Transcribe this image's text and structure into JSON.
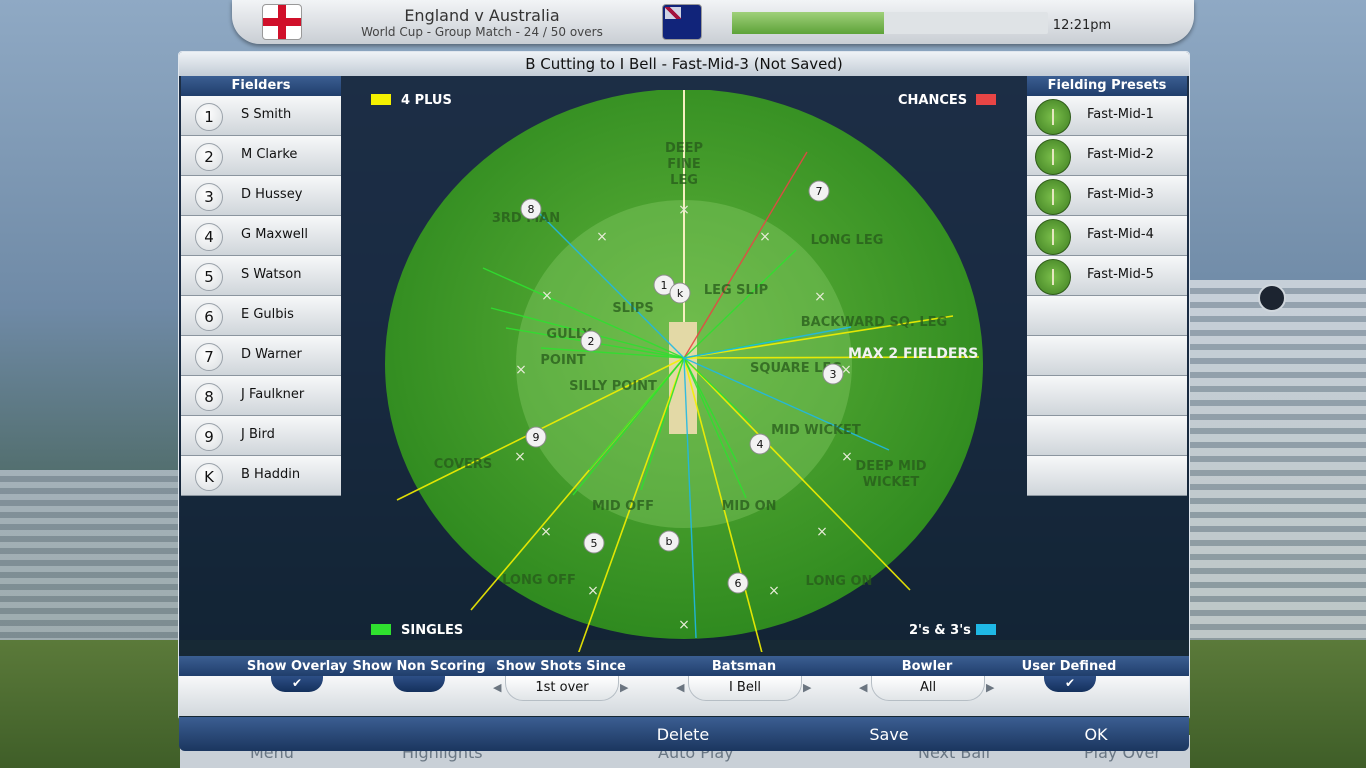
{
  "scoreboard": {
    "match_title": "England v Australia",
    "match_sub": "World Cup - Group Match - 24 / 50 overs",
    "clock": "12:21pm",
    "progress": 0.48
  },
  "background_nav": [
    "Menu",
    "Highlights",
    "Auto Play",
    "Next Ball",
    "Play Over"
  ],
  "dialog": {
    "title": "B Cutting to I Bell - Fast-Mid-3 (Not Saved)"
  },
  "fielders": {
    "heading": "Fielders",
    "items": [
      {
        "num": "1",
        "name": "S Smith"
      },
      {
        "num": "2",
        "name": "M Clarke"
      },
      {
        "num": "3",
        "name": "D Hussey"
      },
      {
        "num": "4",
        "name": "G Maxwell"
      },
      {
        "num": "5",
        "name": "S Watson"
      },
      {
        "num": "6",
        "name": "E Gulbis"
      },
      {
        "num": "7",
        "name": "D Warner"
      },
      {
        "num": "8",
        "name": "J Faulkner"
      },
      {
        "num": "9",
        "name": "J Bird"
      },
      {
        "num": "K",
        "name": "B Haddin"
      }
    ]
  },
  "presets": {
    "heading": "Fielding Presets",
    "items": [
      "Fast-Mid-1",
      "Fast-Mid-2",
      "Fast-Mid-3",
      "Fast-Mid-4",
      "Fast-Mid-5"
    ]
  },
  "legend": {
    "four_plus": "4 PLUS",
    "chances": "CHANCES",
    "singles": "SINGLES",
    "twos_threes": "2's & 3's",
    "max_fielders": "MAX 2 FIELDERS",
    "colors": {
      "four_plus": "#f4f000",
      "chances": "#e84545",
      "singles": "#2fe02f",
      "twos_threes": "#1fb8e6"
    }
  },
  "field_labels": [
    "DEEP FINE LEG",
    "3RD MAN",
    "LONG LEG",
    "LEG SLIP",
    "SLIPS",
    "GULLY",
    "BACKWARD SQ. LEG",
    "POINT",
    "SQUARE LEG",
    "SILLY POINT",
    "MID WICKET",
    "COVERS",
    "DEEP MID WICKET",
    "MID OFF",
    "MID ON",
    "LONG OFF",
    "LONG ON"
  ],
  "field_markers": [
    "1",
    "k",
    "8",
    "7",
    "2",
    "3",
    "9",
    "4",
    "5",
    "b",
    "6"
  ],
  "controls": {
    "show_overlay": "Show Overlay",
    "show_non_scoring": "Show Non Scoring",
    "show_shots_since": "Show Shots Since",
    "shots_since_value": "1st over",
    "batsman": "Batsman",
    "batsman_value": "I Bell",
    "bowler": "Bowler",
    "bowler_value": "All",
    "user_defined": "User Defined",
    "check": "✔"
  },
  "actions": {
    "delete": "Delete",
    "save": "Save",
    "ok": "OK"
  }
}
